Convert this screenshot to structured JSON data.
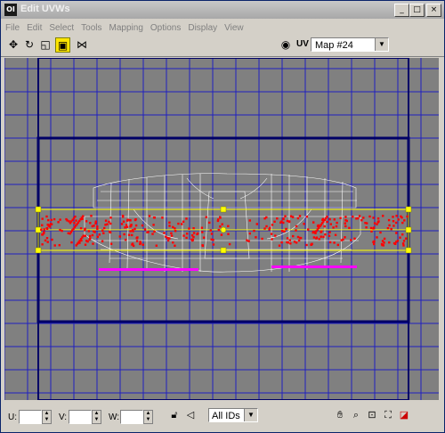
{
  "window": {
    "title": "Edit UVWs",
    "icon_text": "OI",
    "minimize_glyph": "_",
    "maximize_glyph": "□",
    "close_glyph": "×"
  },
  "menu": [
    "File",
    "Edit",
    "Select",
    "Tools",
    "Mapping",
    "Options",
    "Display",
    "View"
  ],
  "toolbar": {
    "tools": [
      "move-icon",
      "rotate-icon",
      "scale-icon",
      "freeform-icon",
      "mirror-icon"
    ],
    "uv_label": "UV",
    "map_select": "Map #24"
  },
  "colors": {
    "canvas": "#808080",
    "grid": "#2020c0",
    "frame": "#000066",
    "selection": "#ffff00",
    "vertices": "#ff0000",
    "wireframe": "#ffffff",
    "magenta": "#ff00ff"
  },
  "status": {
    "u_label": "U:",
    "v_label": "V:",
    "w_label": "W:",
    "u_value": "",
    "v_value": "",
    "w_value": "",
    "id_filter": "All IDs",
    "icons": [
      "lock-icon",
      "brush-icon",
      "pan-icon",
      "zoom-icon",
      "zoom-region-icon",
      "zoom-extents-icon",
      "snap-icon"
    ]
  }
}
